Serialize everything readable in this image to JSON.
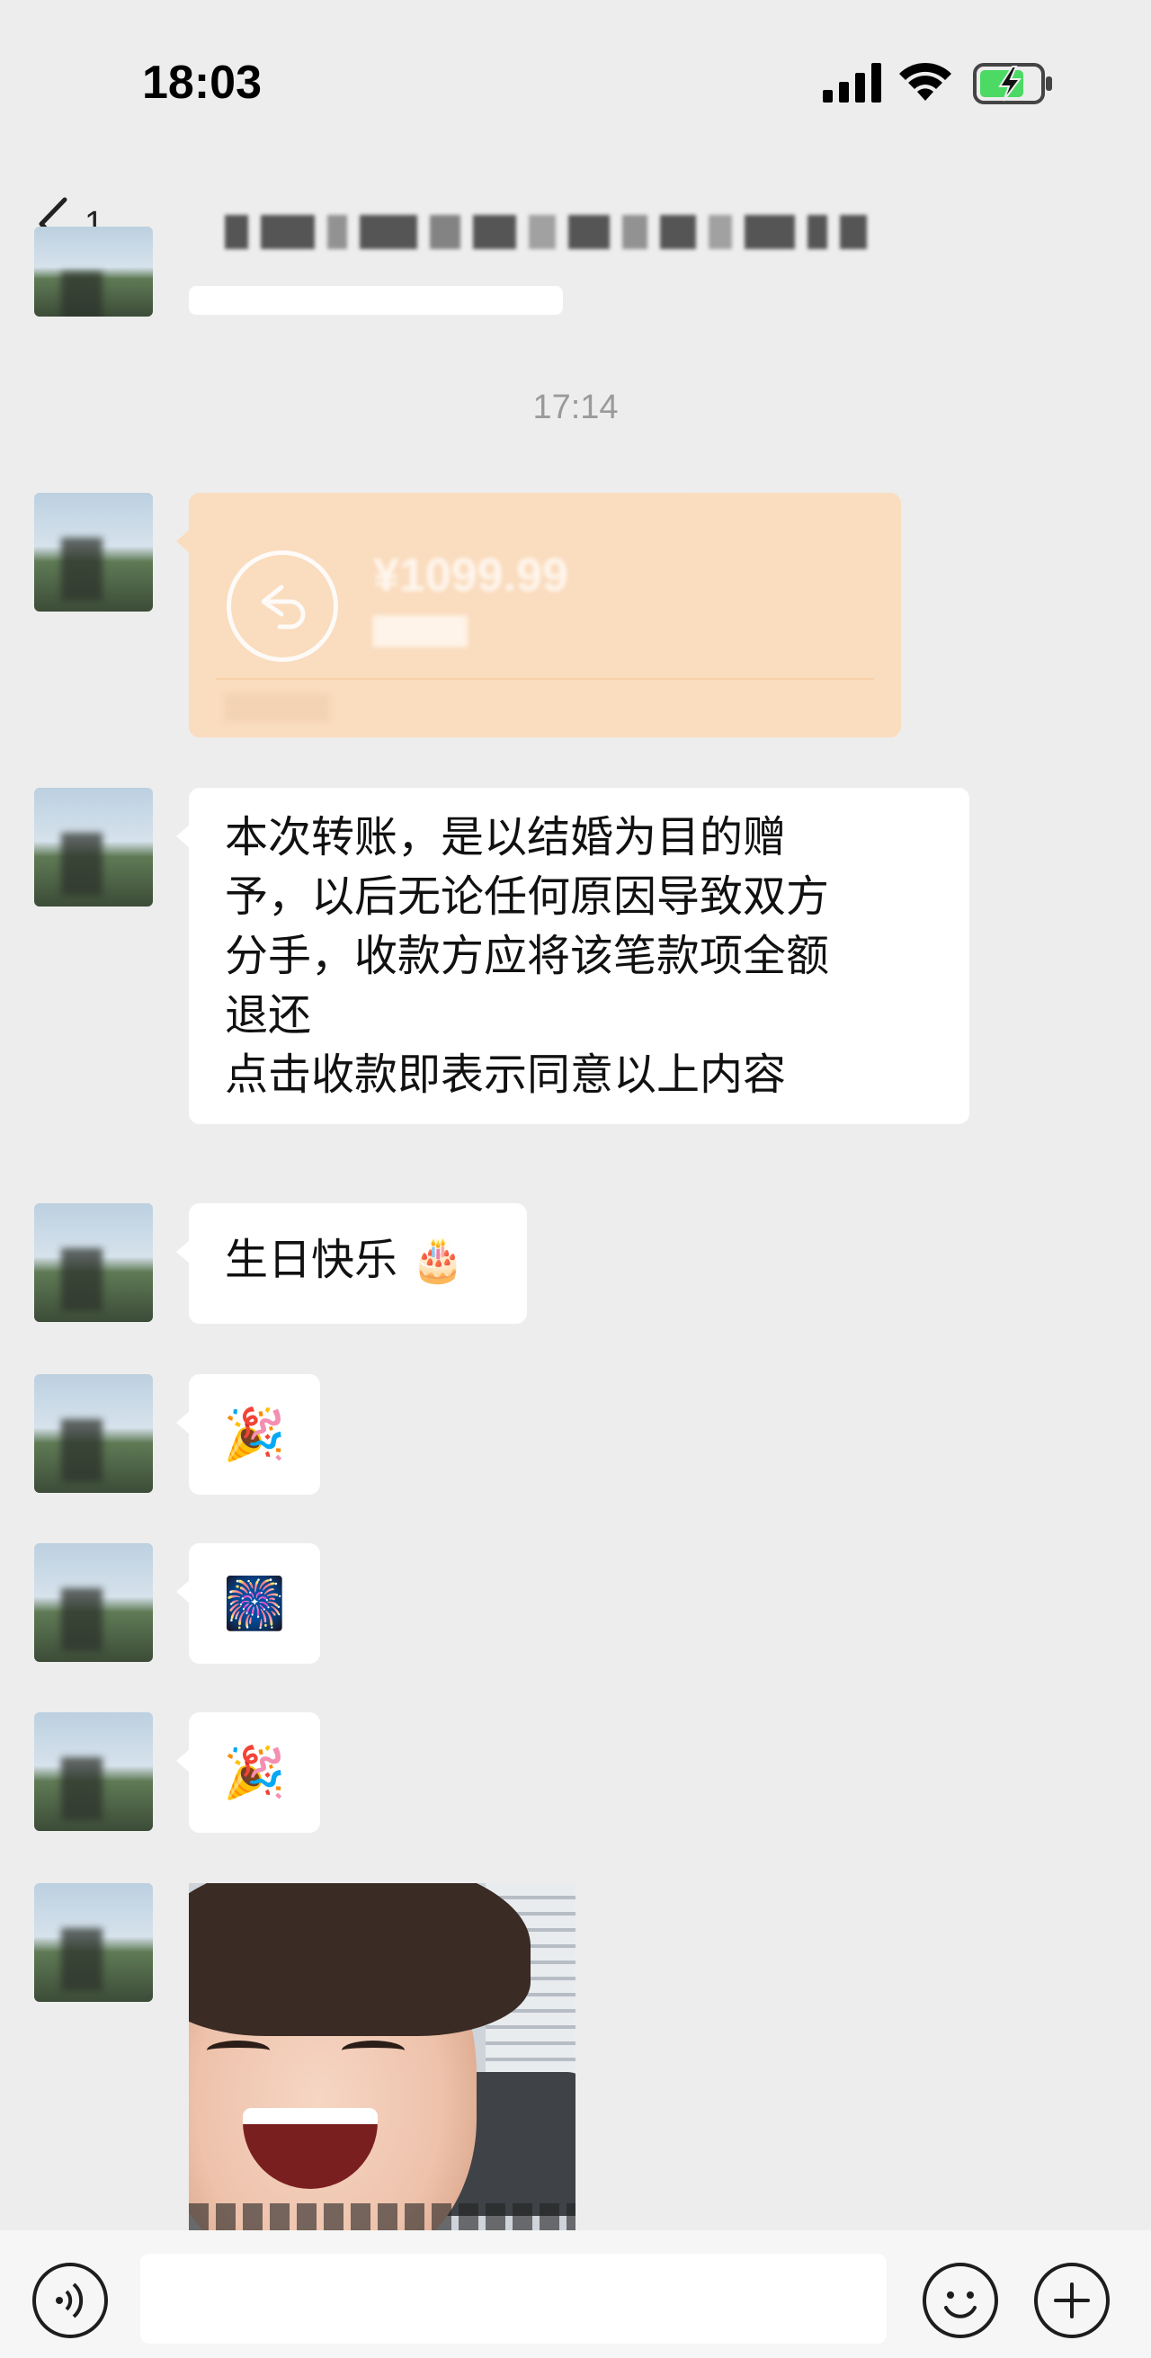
{
  "status_bar": {
    "time": "18:03"
  },
  "nav": {
    "back_count": "1"
  },
  "messages": {
    "timestamp": "17:14",
    "transfer": {
      "amount": "¥1099.99"
    },
    "condition_text_lines": [
      "本次转账，是以结婚为目的赠",
      "予，以后无论任何原因导致双方",
      "分手，收款方应将该笔款项全额",
      "退还",
      "点击收款即表示同意以上内容"
    ],
    "birthday_text": "生日快乐",
    "birthday_emoji": "🎂",
    "emoji_1": "🎉",
    "emoji_2": "🎆",
    "emoji_3": "🎉"
  },
  "colors": {
    "background": "#ededed",
    "bubble": "#ffffff",
    "transfer_card": "#fbdcbc",
    "battery_green": "#4cd964"
  },
  "icons": [
    "signal-icon",
    "wifi-icon",
    "battery-charging-icon",
    "back-chevron-icon",
    "transfer-return-icon",
    "voice-icon",
    "emoji-icon",
    "plus-icon"
  ]
}
